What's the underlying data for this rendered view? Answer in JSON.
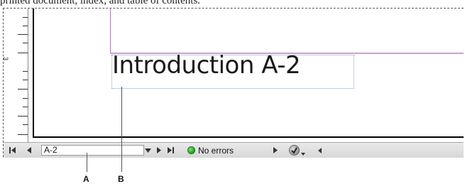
{
  "caption_top": "printed document, index, and table of contents.",
  "ruler": {
    "label_number": "3"
  },
  "document": {
    "heading_text": "Introduction A-2"
  },
  "status_bar": {
    "page_number_value": "A-2",
    "preflight_status": "No errors"
  },
  "callouts": {
    "a": "A",
    "b": "B"
  },
  "colors": {
    "margin_guide": "#d59ad6",
    "status_ok": "#1f9d1f",
    "frame_edge": "#8a9ac8"
  }
}
